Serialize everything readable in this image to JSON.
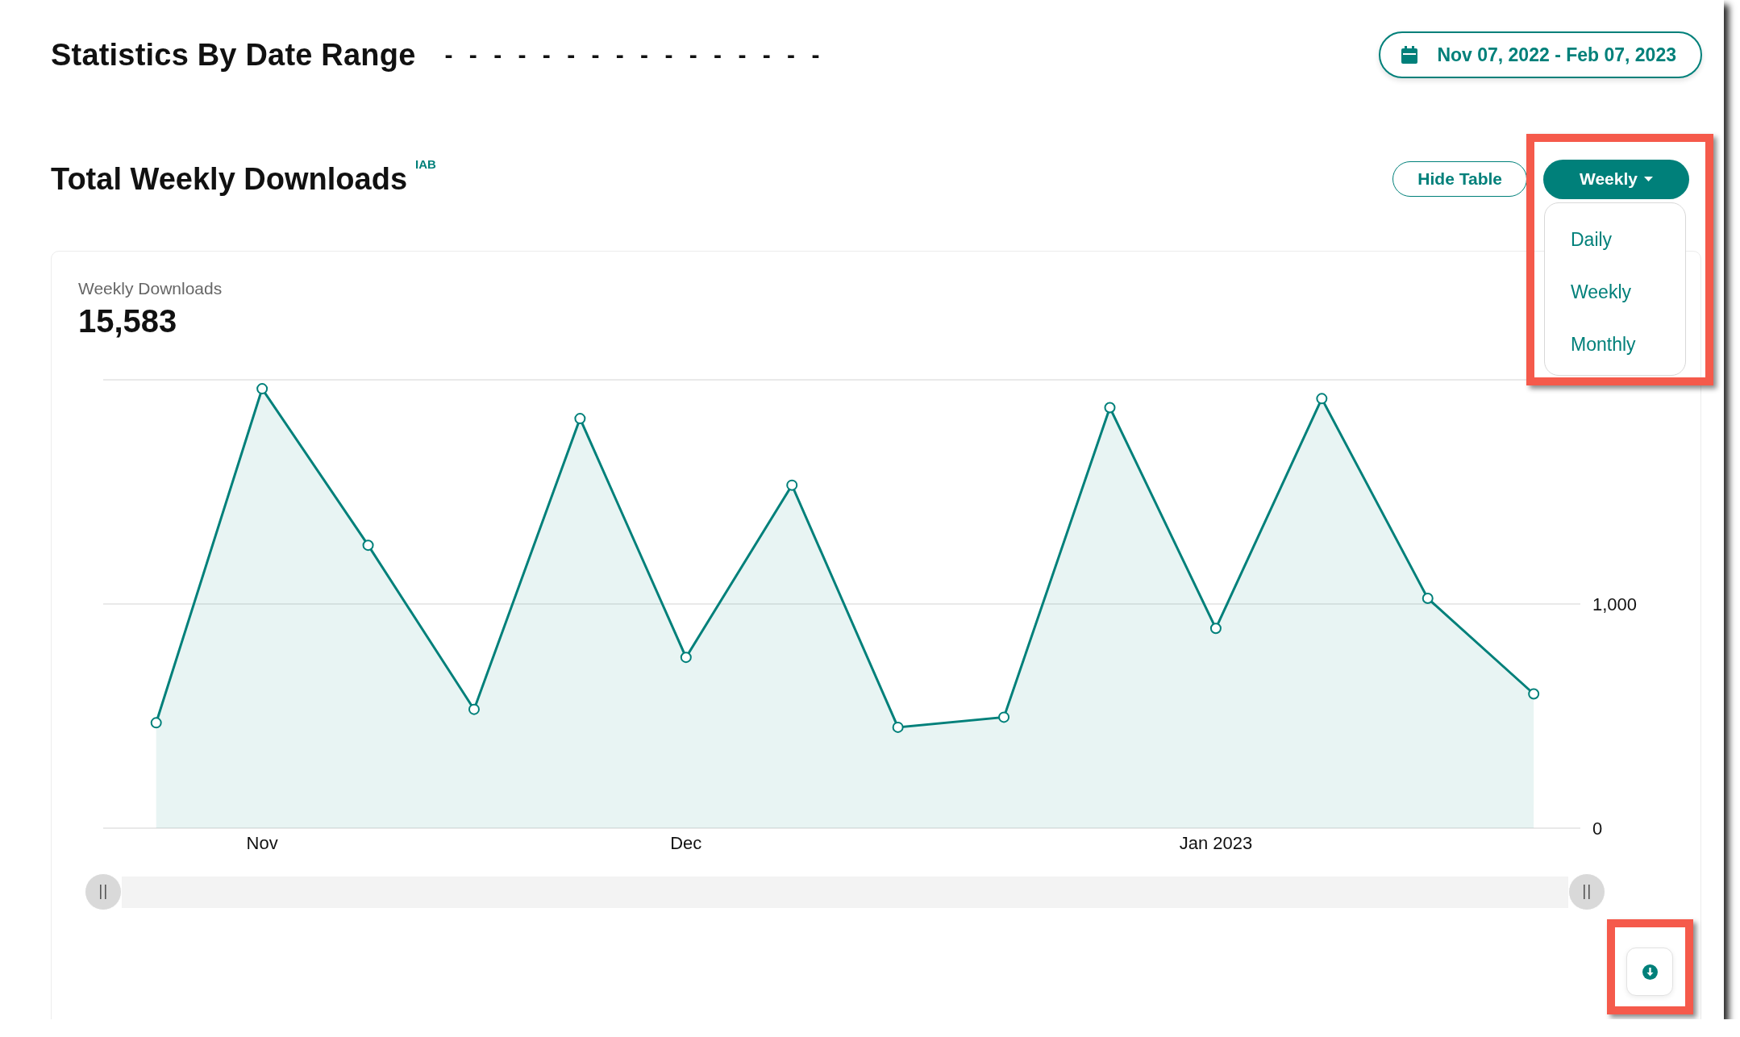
{
  "header": {
    "title": "Statistics By Date Range",
    "redacted": "- - - - - - - - - - - - - - - -",
    "date_range": "Nov 07, 2022 - Feb 07, 2023"
  },
  "section": {
    "title": "Total Weekly Downloads",
    "badge": "IAB",
    "hide_table_button": "Hide Table",
    "period_button": "Weekly",
    "period_menu": {
      "expanded": true,
      "items": [
        {
          "label": "Daily"
        },
        {
          "label": "Weekly"
        },
        {
          "label": "Monthly"
        }
      ]
    }
  },
  "card": {
    "metric_value": "15,583",
    "chart_data": {
      "type": "area",
      "categories": [
        null,
        "Nov",
        null,
        null,
        null,
        "Dec",
        null,
        null,
        null,
        null,
        "Jan 2023",
        null,
        null,
        null
      ],
      "series": [
        {
          "name": "Weekly Downloads",
          "color": "#00807a",
          "values": [
            470,
            1960,
            1262,
            530,
            1827,
            762,
            1530,
            450,
            495,
            1876,
            891,
            1916,
            1025,
            599
          ]
        }
      ],
      "ylim": [
        0,
        2000
      ],
      "yticks": [
        {
          "value": 0,
          "label": "0"
        },
        {
          "value": 1000,
          "label": "1,000"
        }
      ]
    }
  }
}
